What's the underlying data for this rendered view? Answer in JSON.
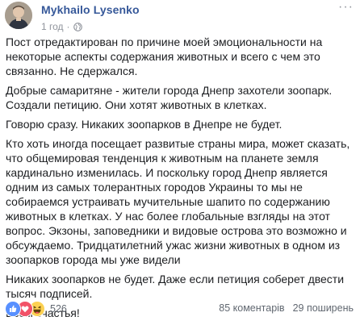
{
  "post": {
    "author": "Mykhailo Lysenko",
    "timestamp": "1 год",
    "separator": "·",
    "privacy_icon": "globe-icon",
    "paragraphs": [
      "Пост отредактирован по причине моей эмоциональности на некоторые аспекты содержания животных и всего с чем это связанно. Не сдержался.",
      "Добрые самаритяне - жители города Днепр захотели зоопарк. Создали петицию. Они хотят животных в клетках.",
      "Говорю сразу. Никаких зоопарков в Днепре не будет.",
      "Кто хоть иногда посещает развитые страны мира, может сказать, что общемировая тенденция к животным на планете земля кардинально изменилась. И поскольку город Днепр является одним из самых толерантных городов Украины то мы не собираемся устраивать мучительные шапито по содержанию животных в клетках. У нас более глобальные взгляды на этот вопрос. Экзоны, заповедники и видовые острова это возможно и обсуждаемо. Тридцатилетний ужас жизни животных в одном из зоопарков города мы уже видели",
      "Никаких зоопарков не будет. Даже если петиция соберет двести тысяч подписей.",
      "Всем счастья!"
    ]
  },
  "reactions": {
    "icons": [
      "like-icon",
      "love-icon",
      "haha-icon"
    ],
    "count": "526"
  },
  "stats": {
    "comments": "85 коментарів",
    "shares": "29 поширень"
  },
  "colors": {
    "author_link": "#365899",
    "meta_text": "#90949c",
    "like_blue": "#5890ff",
    "love_red": "#f25268",
    "haha_yellow": "#fcd152"
  }
}
